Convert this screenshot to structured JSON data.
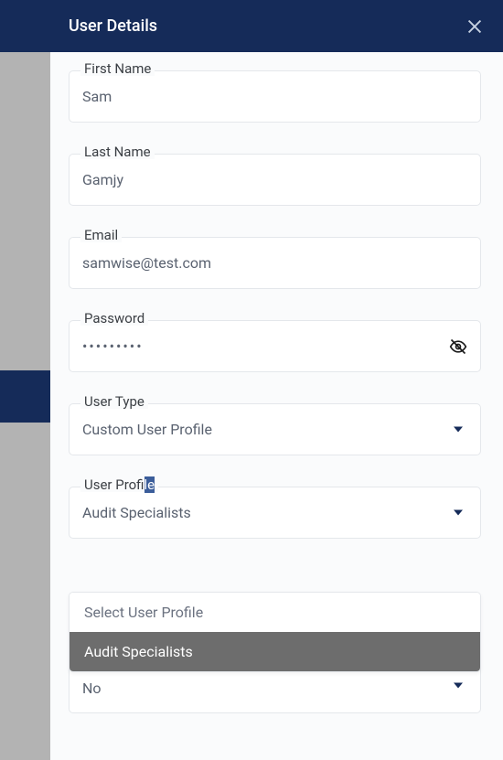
{
  "header": {
    "title": "User Details"
  },
  "fields": {
    "first_name": {
      "label": "First Name",
      "value": "Sam"
    },
    "last_name": {
      "label": "Last Name",
      "value": "Gamjy"
    },
    "email": {
      "label": "Email",
      "value": "samwise@test.com"
    },
    "password": {
      "label": "Password",
      "value": "•••••••••"
    },
    "user_type": {
      "label": "User Type",
      "value": "Custom User Profile"
    },
    "user_profile": {
      "label_pre": "User Prof",
      "label_hl": "ile",
      "value": "Audit Specialists",
      "options": {
        "placeholder": "Select User Profile",
        "selected": "Audit Specialists"
      }
    },
    "hidden_select": {
      "value": "No"
    }
  }
}
